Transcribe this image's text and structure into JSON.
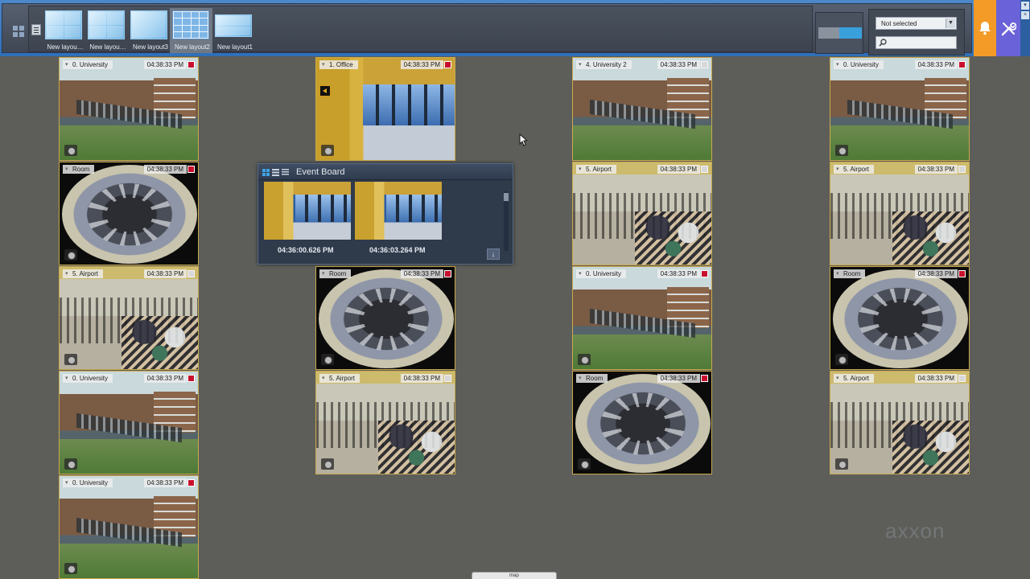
{
  "toolbar": {
    "layouts": [
      {
        "label": "New layou…",
        "thumb": "quad"
      },
      {
        "label": "New layou…",
        "thumb": "quad"
      },
      {
        "label": "New layout3",
        "thumb": "halves"
      },
      {
        "label": "New layout2",
        "thumb": "grid",
        "active": true
      },
      {
        "label": "New layout1",
        "thumb": "halves"
      }
    ],
    "filter_select": "Not selected",
    "search_placeholder": "",
    "accent_alert": "#f39a27",
    "accent_tools": "#6a62d8"
  },
  "cameras": {
    "c0": {
      "name": "0. University",
      "time": "04:38:33 PM",
      "rec": "on",
      "scene": "university"
    },
    "c1": {
      "name": "Room",
      "time": "04:38:33 PM",
      "rec": "on",
      "scene": "room"
    },
    "c2": {
      "name": "5. Airport",
      "time": "04:38:33 PM",
      "rec": "off",
      "scene": "airport"
    },
    "c3": {
      "name": "0. University",
      "time": "04:38:33 PM",
      "rec": "on",
      "scene": "university"
    },
    "c4": {
      "name": "0. University",
      "time": "04:38:33 PM",
      "rec": "on",
      "scene": "university"
    },
    "c5": {
      "name": "1. Office",
      "time": "04:38:33 PM",
      "rec": "on",
      "scene": "office"
    },
    "c6": {
      "name": "Room",
      "time": "04:38:33 PM",
      "rec": "on",
      "scene": "room"
    },
    "c7": {
      "name": "5. Airport",
      "time": "04:38:33 PM",
      "rec": "off",
      "scene": "airport"
    },
    "c8": {
      "name": "4. University 2",
      "time": "04:38:33 PM",
      "rec": "off",
      "scene": "university"
    },
    "c9": {
      "name": "5. Airport",
      "time": "04:38:33 PM",
      "rec": "off",
      "scene": "airport"
    },
    "c10": {
      "name": "0. University",
      "time": "04:38:33 PM",
      "rec": "on",
      "scene": "university"
    },
    "c11": {
      "name": "Room",
      "time": "04:38:33 PM",
      "rec": "on",
      "scene": "room"
    },
    "c12": {
      "name": "0. University",
      "time": "04:38:33 PM",
      "rec": "on",
      "scene": "university"
    },
    "c13": {
      "name": "5. Airport",
      "time": "04:38:33 PM",
      "rec": "off",
      "scene": "airport"
    },
    "c14": {
      "name": "Room",
      "time": "04:38:33 PM",
      "rec": "on",
      "scene": "room"
    },
    "c15": {
      "name": "5. Airport",
      "time": "04:38:33 PM",
      "rec": "off",
      "scene": "airport"
    }
  },
  "event_board": {
    "title": "Event Board",
    "events": [
      {
        "time": "04:36:00.626 PM"
      },
      {
        "time": "04:36:03.264 PM"
      }
    ]
  },
  "map_tab": "map",
  "brand": "axxon"
}
